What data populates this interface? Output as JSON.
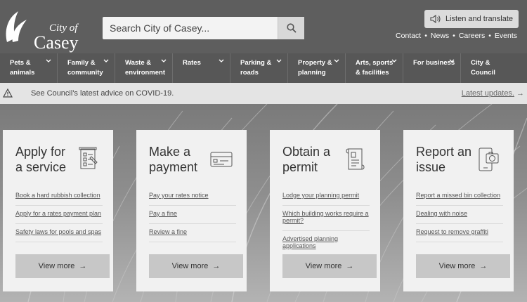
{
  "header": {
    "logo_top": "City of",
    "logo_bottom": "Casey",
    "search_placeholder": "Search City of Casey...",
    "listen_label": "Listen and translate",
    "util_links": [
      "Contact",
      "News",
      "Careers",
      "Events"
    ]
  },
  "nav": {
    "items": [
      {
        "line1": "Pets &",
        "line2": "animals"
      },
      {
        "line1": "Family &",
        "line2": "community"
      },
      {
        "line1": "Waste &",
        "line2": "environment"
      },
      {
        "line1": "Rates",
        "line2": ""
      },
      {
        "line1": "Parking &",
        "line2": "roads"
      },
      {
        "line1": "Property &",
        "line2": "planning"
      },
      {
        "line1": "Arts, sports",
        "line2": "& facilities"
      },
      {
        "line1": "For business",
        "line2": ""
      },
      {
        "line1": "City &",
        "line2": "Council"
      }
    ]
  },
  "alert": {
    "text": "See Council's latest advice on COVID-19.",
    "link": "Latest updates."
  },
  "cards": [
    {
      "title_line1": "Apply for",
      "title_line2": "a service",
      "icon": "checklist-icon",
      "links": [
        "Book a hard rubbish collection",
        "Apply for a rates payment plan",
        "Safety laws for pools and spas"
      ],
      "button": "View more"
    },
    {
      "title_line1": "Make a",
      "title_line2": "payment",
      "icon": "credit-card-icon",
      "links": [
        "Pay your rates notice",
        "Pay a fine",
        "Review a fine"
      ],
      "button": "View more"
    },
    {
      "title_line1": "Obtain a",
      "title_line2": "permit",
      "icon": "permit-scroll-icon",
      "links": [
        "Lodge your planning permit",
        "Which building works require a permit?",
        "Advertised planning applications"
      ],
      "button": "View more"
    },
    {
      "title_line1": "Report an",
      "title_line2": "issue",
      "icon": "phone-camera-icon",
      "links": [
        "Report a missed bin collection",
        "Dealing with noise",
        "Request to remove graffiti"
      ],
      "button": "View more"
    }
  ]
}
